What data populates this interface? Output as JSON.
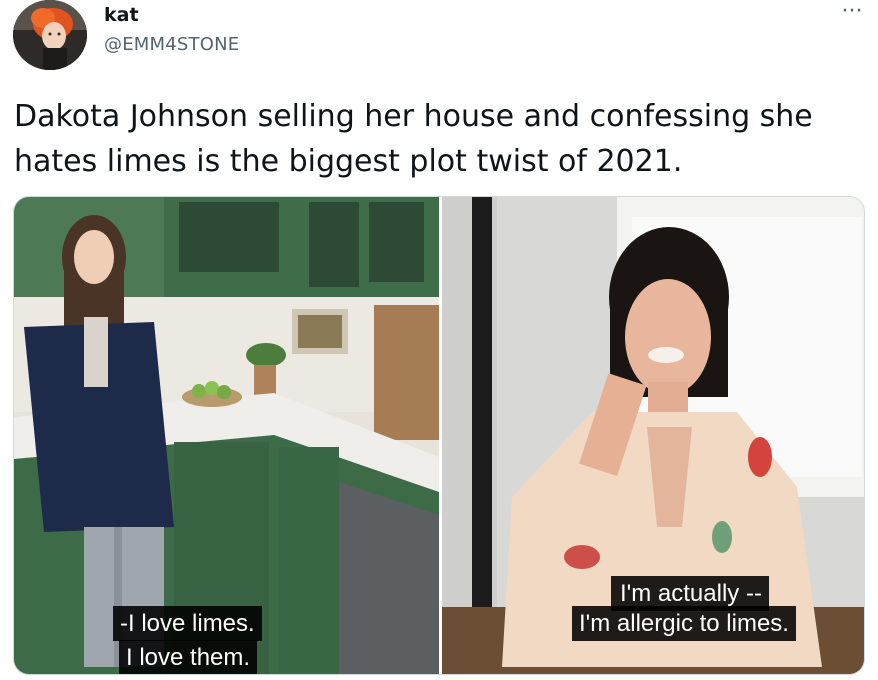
{
  "user": {
    "display_name": "kat",
    "handle": "@EMM4STONE"
  },
  "more_menu_label": "···",
  "tweet": {
    "text": "Dakota Johnson selling her house and confessing she hates limes is the biggest plot twist of 2021."
  },
  "media": {
    "left_caption_line1": "-I love limes.",
    "left_caption_line2": "I love them.",
    "right_caption_line1": "I'm actually --",
    "right_caption_line2": "I'm allergic to limes."
  },
  "colors": {
    "text_primary": "#0f1419",
    "text_secondary": "#536471",
    "border": "#cfd9de",
    "cabinet_green": "#3d6b47"
  },
  "icons": {
    "more": "ellipsis-icon"
  }
}
